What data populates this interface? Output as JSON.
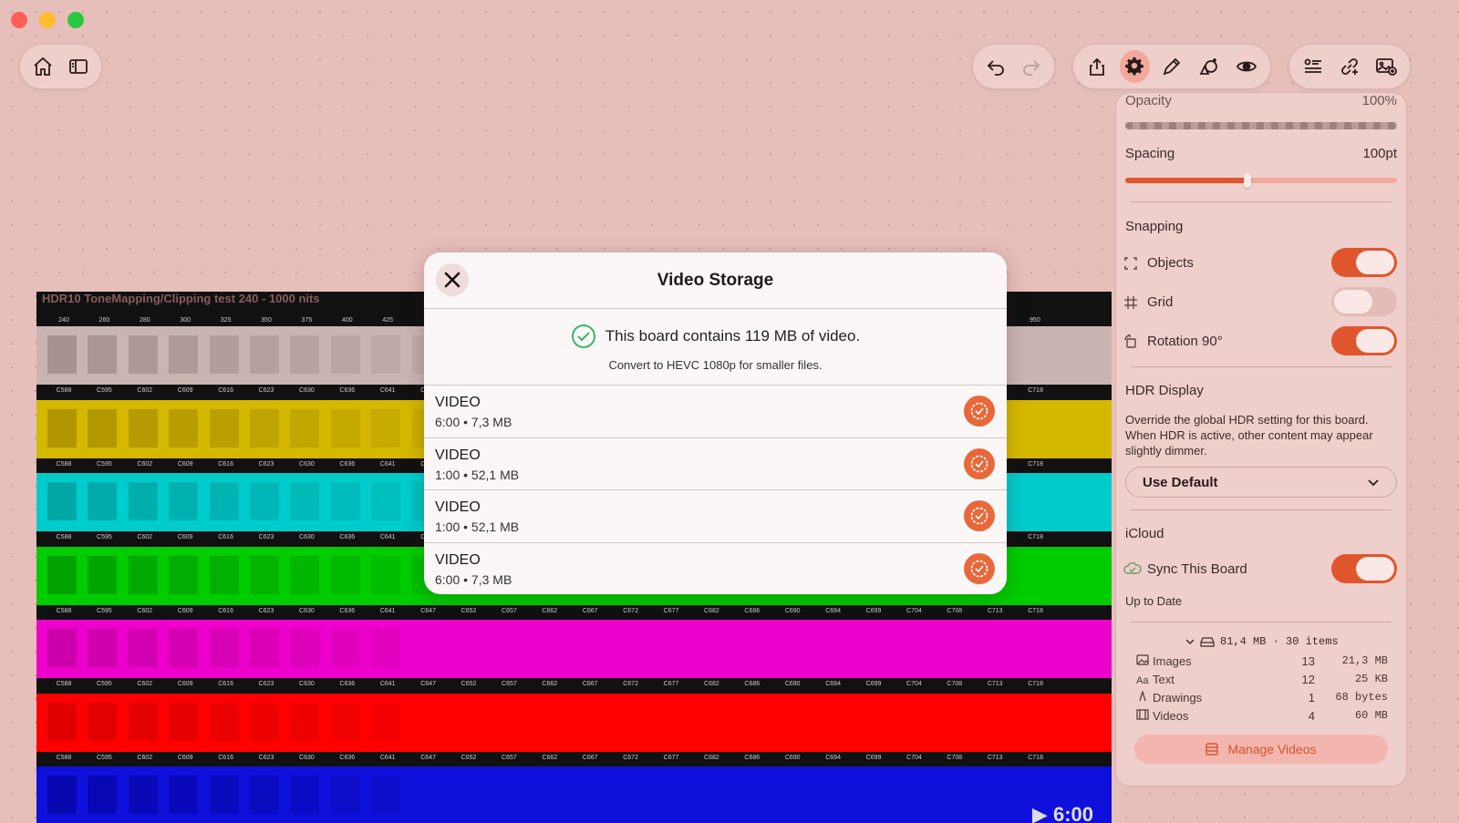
{
  "window": {
    "controls": [
      "close",
      "minimize",
      "zoom"
    ]
  },
  "toolbar": {
    "left": [
      {
        "icon": "home-icon"
      },
      {
        "icon": "sidebar-icon"
      }
    ],
    "history": [
      {
        "icon": "undo-icon"
      },
      {
        "icon": "redo-icon"
      }
    ],
    "tools": [
      {
        "icon": "share-icon"
      },
      {
        "icon": "gear-icon",
        "active": true
      },
      {
        "icon": "pen-icon"
      },
      {
        "icon": "shapes-icon"
      },
      {
        "icon": "eye-icon"
      }
    ],
    "right": [
      {
        "icon": "list-icon"
      },
      {
        "icon": "link-icon"
      },
      {
        "icon": "image-add-icon"
      }
    ]
  },
  "canvas": {
    "title": "HDR10 ToneMapping/Clipping test 240 - 1000 nits",
    "top_ticks": [
      "240",
      "260",
      "280",
      "300",
      "325",
      "350",
      "375",
      "400",
      "425",
      "950"
    ],
    "band_ticks": [
      "C588",
      "C595",
      "C602",
      "C609",
      "C616",
      "C623",
      "C630",
      "C636",
      "C641",
      "C647",
      "C652",
      "C657",
      "C662",
      "C667",
      "C672",
      "C677",
      "C682",
      "C686",
      "C690",
      "C694",
      "C699",
      "C704",
      "C708",
      "C713",
      "C718"
    ],
    "bands": [
      {
        "color": "#c9b4b2",
        "square": "#a89290"
      },
      {
        "color": "#d4b800",
        "square": "#b09400"
      },
      {
        "color": "#00cccc",
        "square": "#00a8a8"
      },
      {
        "color": "#00cc00",
        "square": "#00a300"
      },
      {
        "color": "#ee00cc",
        "square": "#cc00aa"
      },
      {
        "color": "#ff0000",
        "square": "#e00000"
      },
      {
        "color": "#1010dd",
        "square": "#0808b0"
      }
    ],
    "video_time": "6:00"
  },
  "modal": {
    "title": "Video Storage",
    "summary": "This board contains 119 MB of video.",
    "subtitle": "Convert to HEVC 1080p for smaller files.",
    "videos": [
      {
        "title": "VIDEO",
        "meta": "6:00 • 7,3 MB"
      },
      {
        "title": "VIDEO",
        "meta": "1:00 • 52,1 MB"
      },
      {
        "title": "VIDEO",
        "meta": "1:00 • 52,1 MB"
      },
      {
        "title": "VIDEO",
        "meta": "6:00 • 7,3 MB"
      }
    ]
  },
  "panel": {
    "opacity": {
      "label": "Opacity",
      "value": "100%",
      "level": 1.0
    },
    "spacing": {
      "label": "Spacing",
      "value": "100pt",
      "level": 0.45
    },
    "snapping": {
      "title": "Snapping",
      "items": [
        {
          "label": "Objects",
          "icon": "bracket-icon",
          "on": true
        },
        {
          "label": "Grid",
          "icon": "grid-icon",
          "on": false
        },
        {
          "label": "Rotation 90°",
          "icon": "rotate-icon",
          "on": true
        }
      ]
    },
    "hdr": {
      "title": "HDR Display",
      "description": "Override the global HDR setting for this board. When HDR is active, other content may appear slightly dimmer.",
      "select_value": "Use Default"
    },
    "icloud": {
      "title": "iCloud",
      "sync_label": "Sync This Board",
      "sync_on": true,
      "status": "Up to Date"
    },
    "storage": {
      "total": "81,4 MB · 30 items",
      "rows": [
        {
          "icon": "image-icon",
          "label": "Images",
          "count": "13",
          "size": "21,3 MB"
        },
        {
          "icon": "text-icon",
          "label": "Text",
          "count": "12",
          "size": "25 KB"
        },
        {
          "icon": "drawing-icon",
          "label": "Drawings",
          "count": "1",
          "size": "68 bytes"
        },
        {
          "icon": "film-icon",
          "label": "Videos",
          "count": "4",
          "size": "60 MB"
        }
      ],
      "manage_label": "Manage Videos"
    }
  }
}
